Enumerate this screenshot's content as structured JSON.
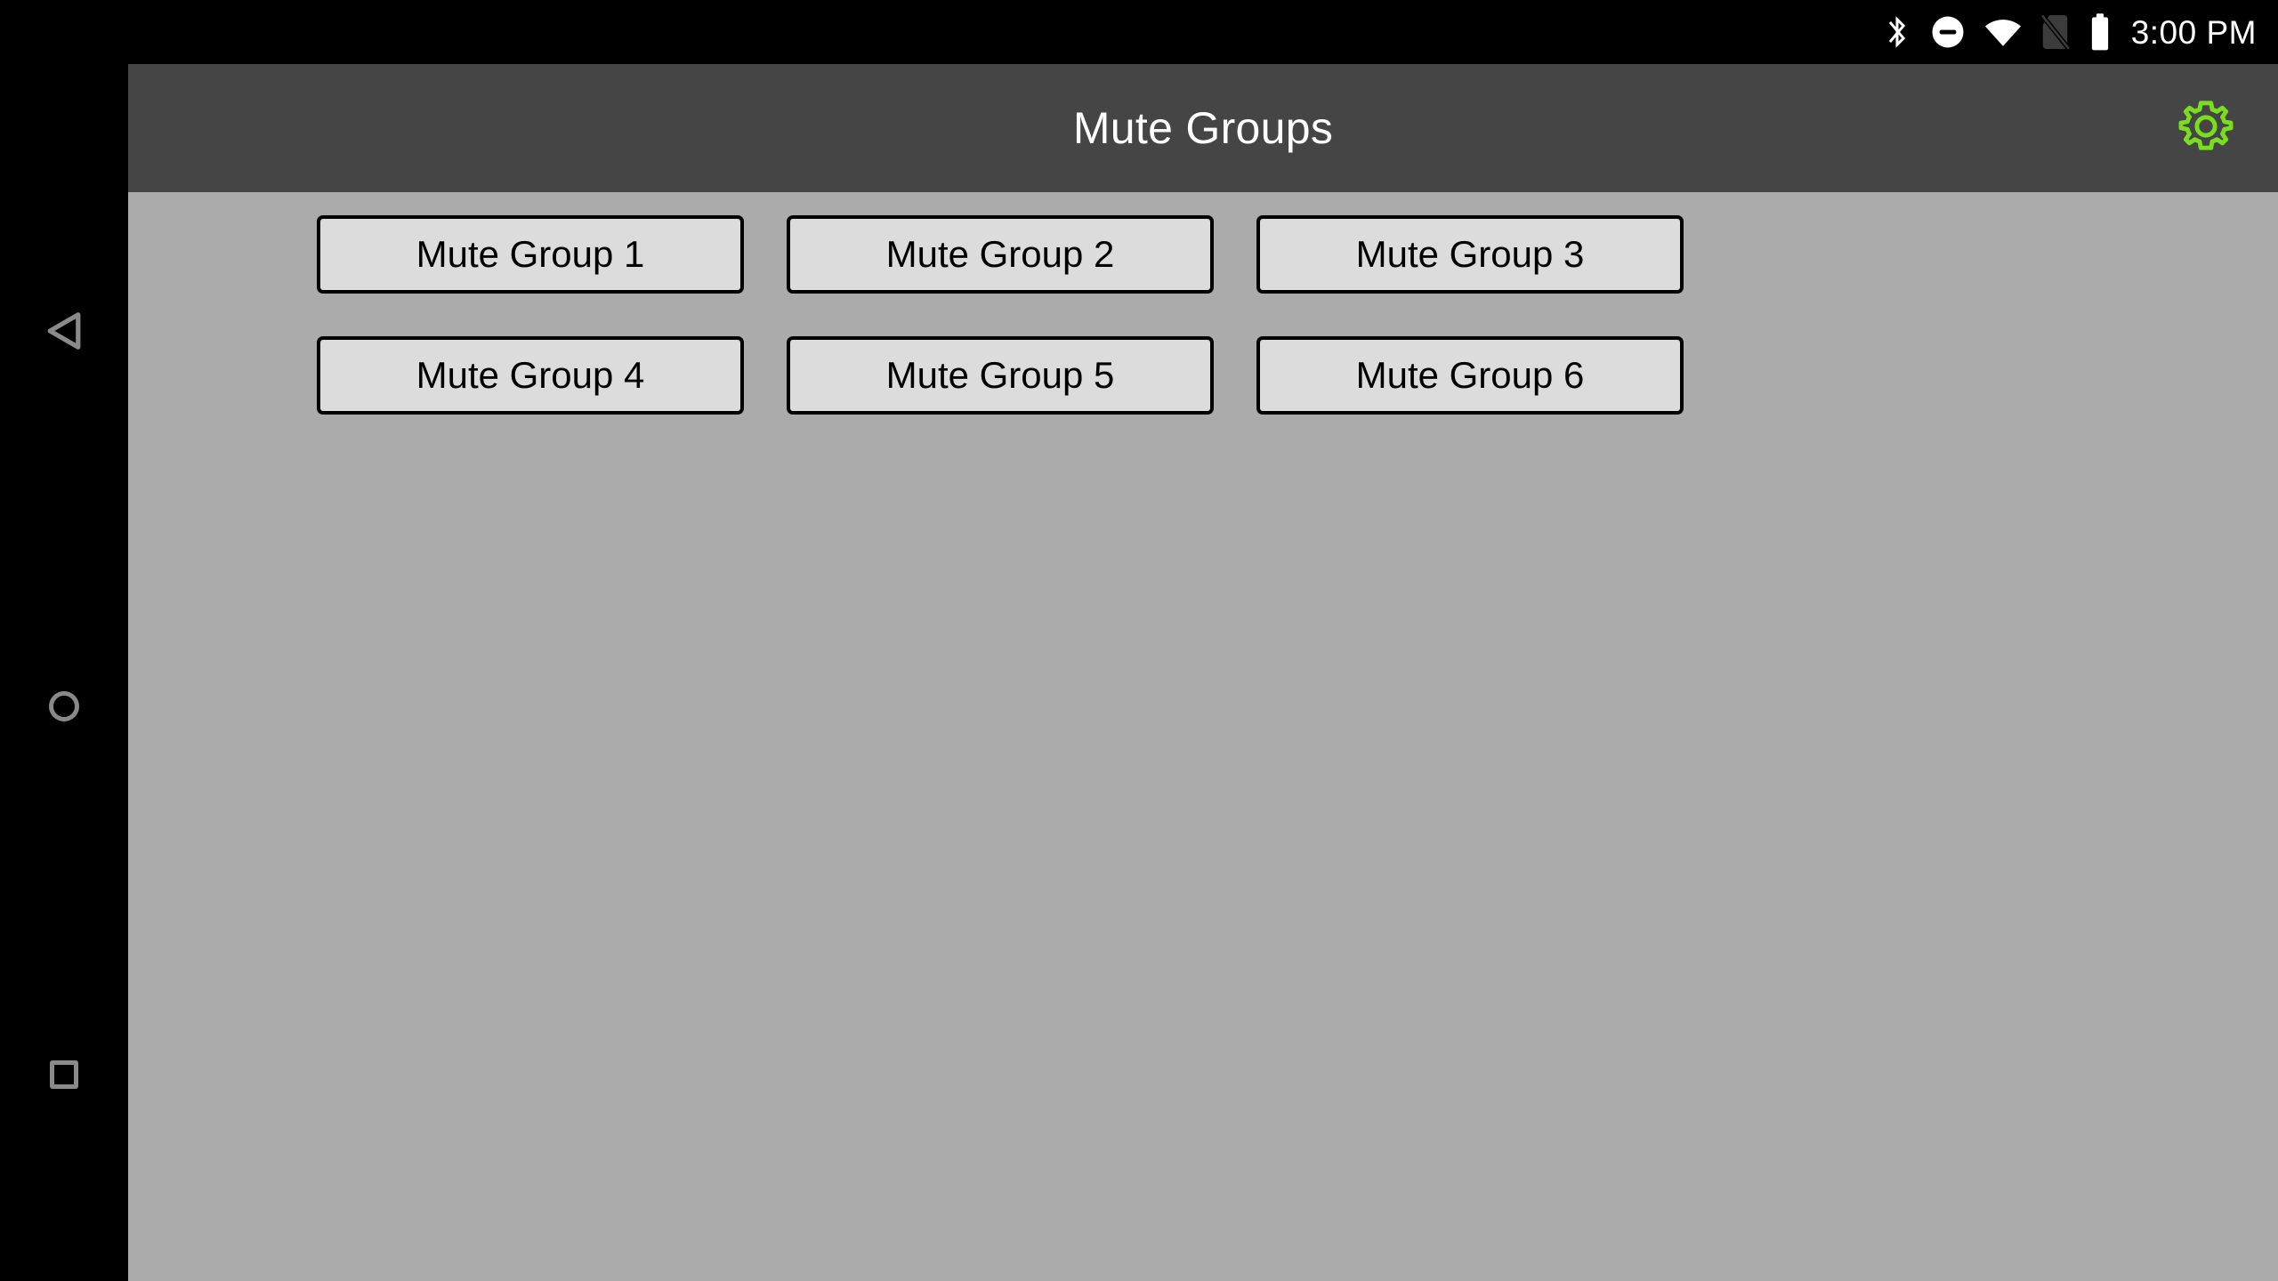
{
  "status_bar": {
    "clock": "3:00 PM",
    "icons": [
      {
        "name": "bluetooth-icon",
        "label": "Bluetooth"
      },
      {
        "name": "do-not-disturb-icon",
        "label": "Do Not Disturb"
      },
      {
        "name": "wifi-icon",
        "label": "Wi-Fi"
      },
      {
        "name": "no-sim-card-icon",
        "label": "No SIM card"
      },
      {
        "name": "battery-icon",
        "label": "Battery"
      }
    ],
    "background_color": "#000000",
    "foreground_color": "#ffffff",
    "disabled_icon_color": "#3c3c3c"
  },
  "navigation_bar": {
    "background_color": "#000000",
    "icon_color": "#8a8a8a",
    "buttons": [
      {
        "name": "nav-back-button",
        "label": "Back"
      },
      {
        "name": "nav-home-button",
        "label": "Home"
      },
      {
        "name": "nav-recents-button",
        "label": "Recent apps"
      }
    ]
  },
  "app_bar": {
    "title": "Mute Groups",
    "background_color": "#454545",
    "title_color": "#ffffff",
    "settings_icon": {
      "name": "gear-icon",
      "label": "Settings",
      "color": "#7ade1f"
    }
  },
  "content": {
    "background_color": "#ababab",
    "button_fill_color": "#dcdcdc",
    "button_border_color": "#000000",
    "button_text_color": "#000000",
    "mute_groups": [
      {
        "label": "Mute Group 1"
      },
      {
        "label": "Mute Group 2"
      },
      {
        "label": "Mute Group 3"
      },
      {
        "label": "Mute Group 4"
      },
      {
        "label": "Mute Group 5"
      },
      {
        "label": "Mute Group 6"
      }
    ]
  }
}
